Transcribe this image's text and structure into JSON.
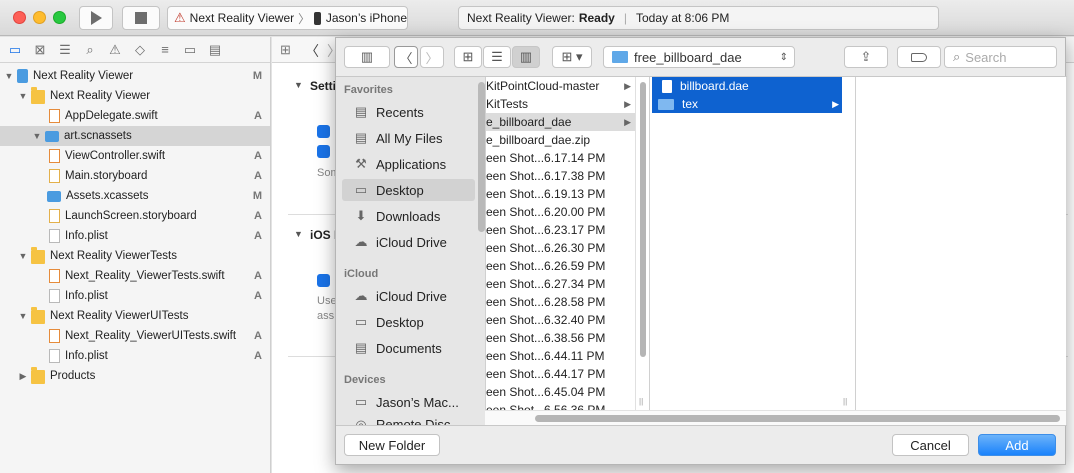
{
  "toolbar": {
    "scheme": "Next Reality Viewer",
    "device": "Jason’s iPhone",
    "status_app": "Next Reality Viewer:",
    "status_state": "Ready",
    "status_time": "Today at 8:06 PM"
  },
  "navigator": {
    "items": [
      {
        "label": "Next Reality Viewer",
        "badge": "M"
      },
      {
        "label": "Next Reality Viewer",
        "badge": ""
      },
      {
        "label": "AppDelegate.swift",
        "badge": "A"
      },
      {
        "label": "art.scnassets",
        "badge": ""
      },
      {
        "label": "ViewController.swift",
        "badge": "A"
      },
      {
        "label": "Main.storyboard",
        "badge": "A"
      },
      {
        "label": "Assets.xcassets",
        "badge": "M"
      },
      {
        "label": "LaunchScreen.storyboard",
        "badge": "A"
      },
      {
        "label": "Info.plist",
        "badge": "A"
      },
      {
        "label": "Next Reality ViewerTests",
        "badge": ""
      },
      {
        "label": "Next_Reality_ViewerTests.swift",
        "badge": "A"
      },
      {
        "label": "Info.plist",
        "badge": "A"
      },
      {
        "label": "Next Reality ViewerUITests",
        "badge": ""
      },
      {
        "label": "Next_Reality_ViewerUITests.swift",
        "badge": "A"
      },
      {
        "label": "Info.plist",
        "badge": "A"
      },
      {
        "label": "Products",
        "badge": ""
      }
    ]
  },
  "editor": {
    "section1": "Setti",
    "text1": "Som",
    "section2": "iOS I",
    "text2a": "Use",
    "text2b": "ass"
  },
  "dialog": {
    "path": "free_billboard_dae",
    "search_placeholder": "Search",
    "favorites_header": "Favorites",
    "favorites": [
      "Recents",
      "All My Files",
      "Applications",
      "Desktop",
      "Downloads",
      "iCloud Drive"
    ],
    "icloud_header": "iCloud",
    "icloud": [
      "iCloud Drive",
      "Desktop",
      "Documents"
    ],
    "devices_header": "Devices",
    "devices": [
      "Jason’s Mac...",
      "Remote Disc"
    ],
    "column1": [
      "KitPointCloud-master",
      "KitTests",
      "e_billboard_dae",
      "e_billboard_dae.zip",
      "een Shot...6.17.14 PM",
      "een Shot...6.17.38 PM",
      "een Shot...6.19.13 PM",
      "een Shot...6.20.00 PM",
      "een Shot...6.23.17 PM",
      "een Shot...6.26.30 PM",
      "een Shot...6.26.59 PM",
      "een Shot...6.27.34 PM",
      "een Shot...6.28.58 PM",
      "een Shot...6.32.40 PM",
      "een Shot...6.38.56 PM",
      "een Shot...6.44.11 PM",
      "een Shot...6.44.17 PM",
      "een Shot...6.45.04 PM",
      "een Shot...6.56.36 PM"
    ],
    "column2": [
      "billboard.dae",
      "tex"
    ],
    "new_folder": "New Folder",
    "cancel": "Cancel",
    "add": "Add"
  }
}
